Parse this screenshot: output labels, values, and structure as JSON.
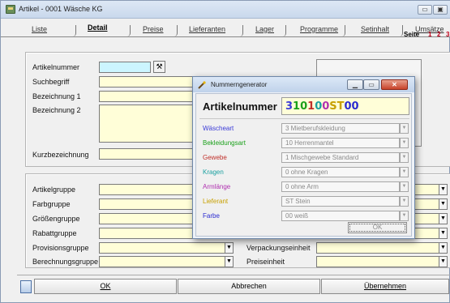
{
  "window": {
    "title": "Artikel - 0001 Wäsche KG"
  },
  "tabs": [
    {
      "label": "Liste"
    },
    {
      "label": "Detail"
    },
    {
      "label": "Preise"
    },
    {
      "label": "Lieferanten"
    },
    {
      "label": "Lager"
    },
    {
      "label": "Programme"
    },
    {
      "label": "Setinhalt"
    },
    {
      "label": "Umsätze"
    }
  ],
  "pager": {
    "label": "Seite",
    "pages": [
      "1",
      "2",
      "3"
    ]
  },
  "top_fields": {
    "artikelnummer": "Artikelnummer",
    "suchbegriff": "Suchbegriff",
    "bezeichnung1": "Bezeichnung 1",
    "bezeichnung2": "Bezeichnung 2",
    "kurzbezeichnung": "Kurzbezeichnung"
  },
  "groups": {
    "artikelgruppe": "Artikelgruppe",
    "farbgruppe": "Farbgruppe",
    "groessengruppe": "Größengruppe",
    "rabattgruppe": "Rabattgruppe",
    "provisionsgruppe": "Provisionsgruppe",
    "berechnungsgruppe": "Berechnungsgruppe",
    "verpackungseinheit": "Verpackungseinheit",
    "preiseinheit": "Preiseinheit"
  },
  "buttons": {
    "ok": "OK",
    "abbrechen": "Abbrechen",
    "uebernehmen": "Übernehmen"
  },
  "dialog": {
    "title": "Nummerngenerator",
    "artnr_label": "Artikelnummer",
    "artnr_parts": [
      {
        "text": "3",
        "color": "#3a3ad8"
      },
      {
        "text": "10",
        "color": "#1aa01a"
      },
      {
        "text": "1",
        "color": "#c0302a"
      },
      {
        "text": "0",
        "color": "#1aa0a0"
      },
      {
        "text": "0",
        "color": "#b030b0"
      },
      {
        "text": "ST",
        "color": "#c8a000"
      },
      {
        "text": "00",
        "color": "#2a2ad0"
      }
    ],
    "rows": [
      {
        "label": "Wäscheart",
        "color": "#3a3ad8",
        "value": "3  Mietberufskleidung"
      },
      {
        "label": "Bekleidungsart",
        "color": "#1aa01a",
        "value": "10  Herrenmantel"
      },
      {
        "label": "Gewebe",
        "color": "#c0302a",
        "value": "1  Mischgewebe Standard"
      },
      {
        "label": "Kragen",
        "color": "#1aa0a0",
        "value": "0  ohne Kragen"
      },
      {
        "label": "Armlänge",
        "color": "#b030b0",
        "value": "0  ohne Arm"
      },
      {
        "label": "Lieferant",
        "color": "#c8a000",
        "value": "ST  Stein"
      },
      {
        "label": "Farbe",
        "color": "#2a2ad0",
        "value": "00  weiß"
      }
    ],
    "ok": "OK"
  }
}
